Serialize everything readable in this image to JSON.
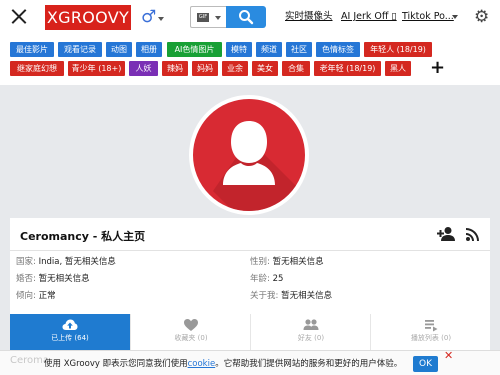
{
  "header": {
    "logo": "XGROOVY",
    "search_type_icon": "GIF",
    "links": [
      {
        "label": "实时摄像头"
      },
      {
        "label": "AI Jerk Off ▯"
      },
      {
        "label": "Tiktok Po..."
      }
    ]
  },
  "categories": [
    {
      "label": "最佳影片",
      "color": "blue"
    },
    {
      "label": "观看记录",
      "color": "blue"
    },
    {
      "label": "动图",
      "color": "blue"
    },
    {
      "label": "相册",
      "color": "blue"
    },
    {
      "label": "AI色情图片",
      "color": "green"
    },
    {
      "label": "模特",
      "color": "blue"
    },
    {
      "label": "频道",
      "color": "blue"
    },
    {
      "label": "社区",
      "color": "blue"
    },
    {
      "label": "色情标签",
      "color": "blue"
    },
    {
      "label": "年轻人 (18/19)",
      "color": "red"
    },
    {
      "label": "继家庭幻想",
      "color": "red"
    },
    {
      "label": "青少年 (18+)",
      "color": "red"
    },
    {
      "label": "人妖",
      "color": "purple"
    },
    {
      "label": "辣妈",
      "color": "red"
    },
    {
      "label": "妈妈",
      "color": "red"
    },
    {
      "label": "业余",
      "color": "red"
    },
    {
      "label": "美女",
      "color": "red"
    },
    {
      "label": "合集",
      "color": "red"
    },
    {
      "label": "老年轻 (18/19)",
      "color": "red"
    },
    {
      "label": "黑人",
      "color": "red"
    }
  ],
  "profile": {
    "title": "Ceromancy - 私人主页",
    "fields": [
      {
        "key": "国家:",
        "value": "India, 暂无相关信息"
      },
      {
        "key": "性别:",
        "value": "暂无相关信息"
      },
      {
        "key": "婚否:",
        "value": "暂无相关信息"
      },
      {
        "key": "年龄:",
        "value": "25"
      },
      {
        "key": "倾向:",
        "value": "正常"
      },
      {
        "key": "关于我:",
        "value": "暂无相关信息"
      }
    ],
    "tabs": [
      {
        "label": "已上传 (64)",
        "icon": "cloud-upload-icon"
      },
      {
        "label": "收藏夹 (0)",
        "icon": "heart-icon"
      },
      {
        "label": "好友 (0)",
        "icon": "friends-icon"
      },
      {
        "label": "播放列表 (0)",
        "icon": "playlist-icon"
      }
    ]
  },
  "cookie": {
    "ghost_text": "Ceroma",
    "text_before": "使用 XGroovy 即表示您同意我们使用",
    "link": "cookie",
    "text_after": "。它帮助我们提供网站的服务和更好的用户体验。",
    "ok_label": "OK",
    "close_label": "✕"
  },
  "colors": {
    "logo_red": "#d8221b",
    "accent_blue": "#1f7bd0",
    "tag_blue": "#2576d6",
    "tag_green": "#18a035",
    "tag_red": "#d42820",
    "tag_purple": "#7a2fb5",
    "avatar_red": "#d82a33"
  }
}
